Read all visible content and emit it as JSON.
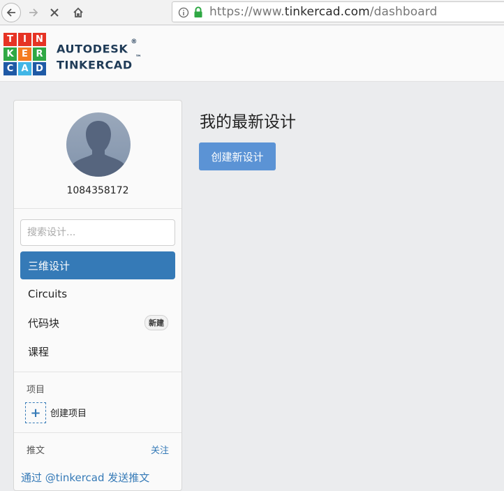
{
  "browser": {
    "url_prefix": "https://www.",
    "url_host": "tinkercad.com",
    "url_path": "/dashboard"
  },
  "header": {
    "logo_letters": [
      "T",
      "I",
      "N",
      "K",
      "E",
      "R",
      "C",
      "A",
      "D"
    ],
    "logo_colors": [
      "#e63324",
      "#e63324",
      "#e63324",
      "#2fa844",
      "#f47b20",
      "#2fa844",
      "#1f5aa6",
      "#41b6e6",
      "#1f5aa6"
    ],
    "brand_line1": "AUTODESK",
    "brand_mark1": "®",
    "brand_line2": "TINKERCAD",
    "brand_mark2": "™"
  },
  "sidebar": {
    "username": "1084358172",
    "search_placeholder": "搜索设计...",
    "menu": [
      {
        "label": "三维设计",
        "active": true
      },
      {
        "label": "Circuits",
        "active": false
      },
      {
        "label": "代码块",
        "active": false,
        "badge": "新建"
      },
      {
        "label": "课程",
        "active": false
      }
    ],
    "projects_label": "项目",
    "create_project_label": "创建项目",
    "tweets_label": "推文",
    "follow_label": "关注",
    "tweet_link": "通过 @tinkercad 发送推文"
  },
  "main": {
    "title": "我的最新设计",
    "create_button": "创建新设计"
  },
  "colors": {
    "accent": "#357ab7",
    "button": "#5b93d5",
    "brand_text": "#1f3b57",
    "lock_green": "#2fa844"
  }
}
